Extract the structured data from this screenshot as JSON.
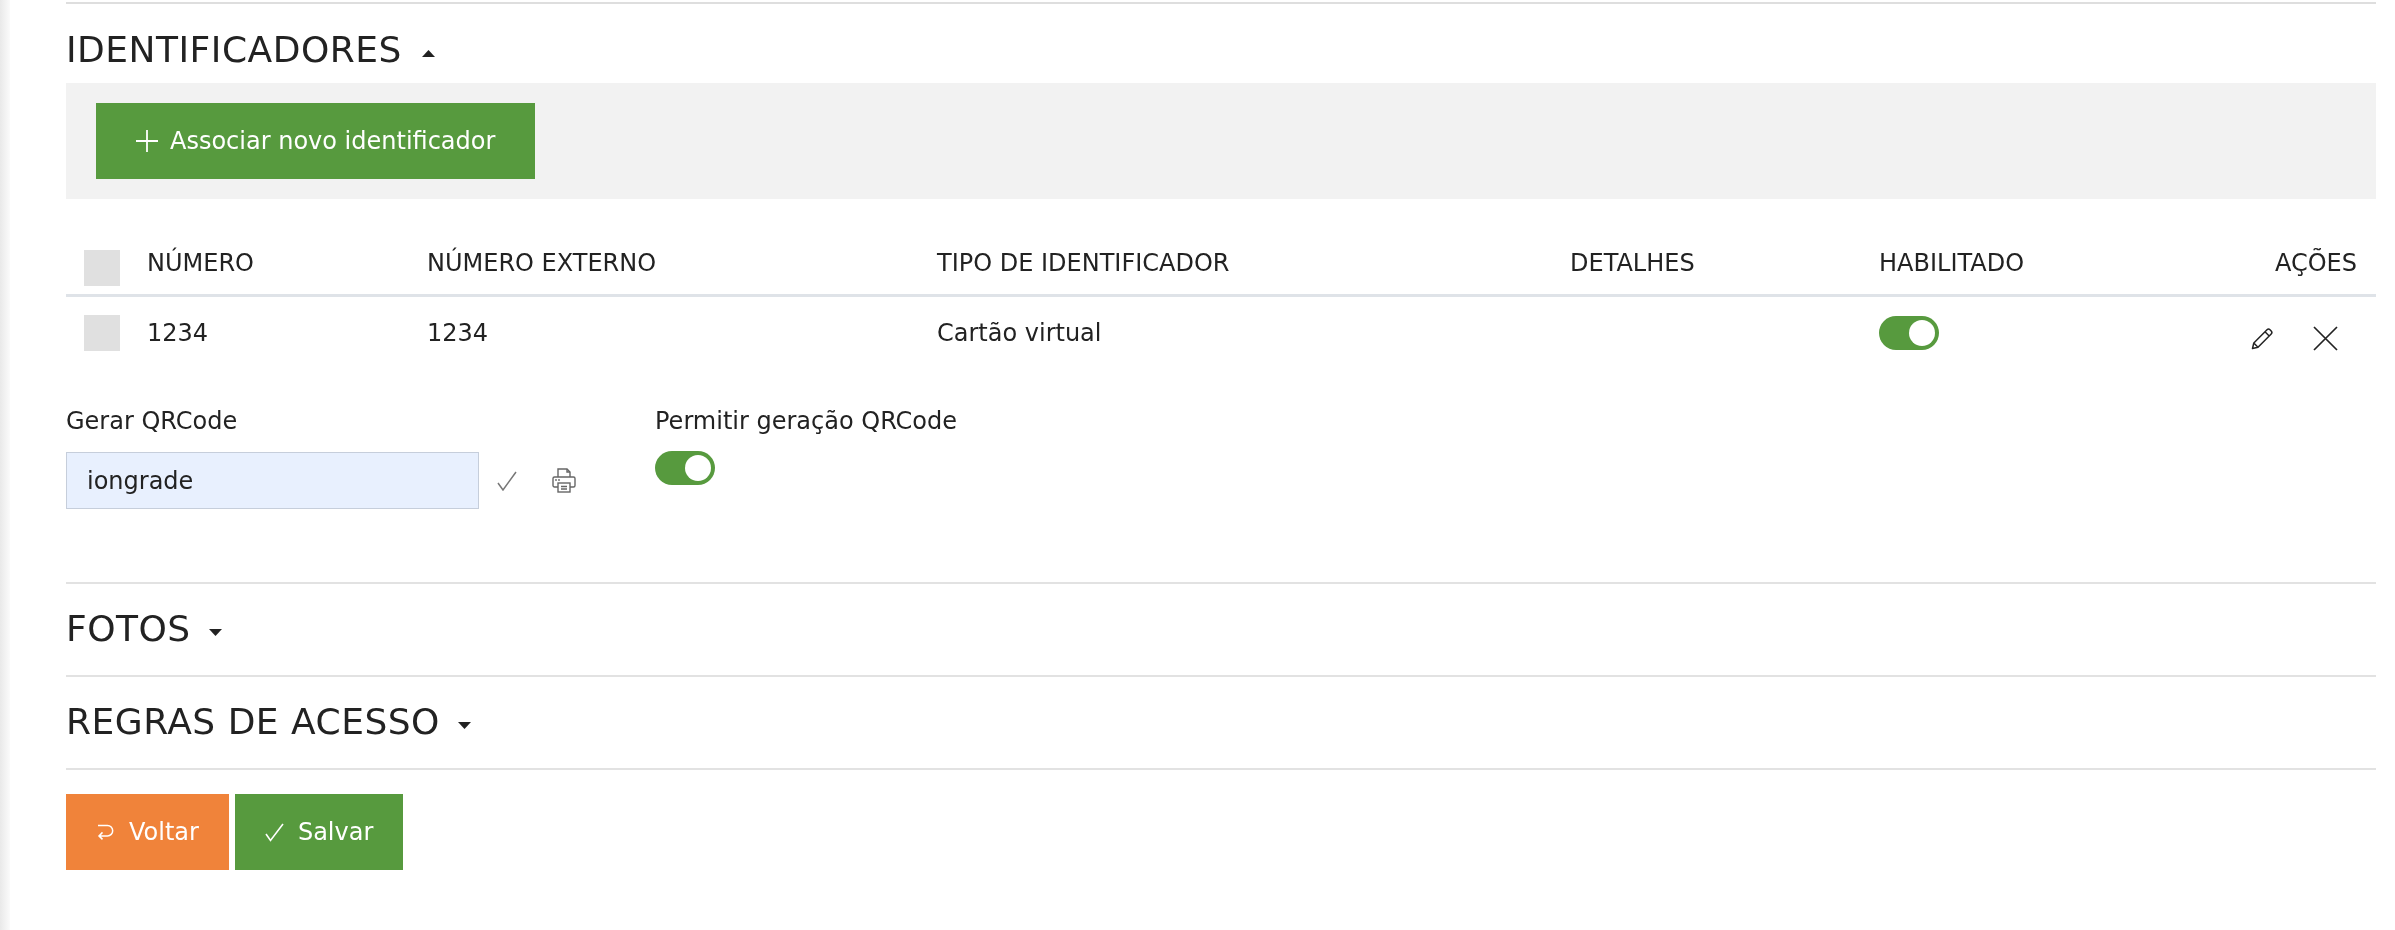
{
  "identifiers": {
    "title": "IDENTIFICADORES",
    "expanded": true,
    "add_button": "Associar novo identificador",
    "table": {
      "select_all_checked": false,
      "columns": [
        "NÚMERO",
        "NÚMERO EXTERNO",
        "TIPO DE IDENTIFICADOR",
        "DETALHES",
        "HABILITADO",
        "AÇÕES"
      ],
      "rows": [
        {
          "checked": false,
          "number": "1234",
          "external_number": "1234",
          "identifier_type": "Cartão virtual",
          "enabled": true
        }
      ]
    },
    "qrcode": {
      "label": "Gerar QRCode",
      "value": "iongrade",
      "allow_label": "Permitir geração QRCode",
      "allow": true
    }
  },
  "sections": [
    {
      "title": "FOTOS",
      "expanded": false
    },
    {
      "title": "REGRAS DE ACESSO",
      "expanded": false
    }
  ],
  "footer_buttons": [
    {
      "label": "Voltar",
      "kind": "back"
    },
    {
      "label": "Salvar",
      "kind": "save"
    }
  ]
}
